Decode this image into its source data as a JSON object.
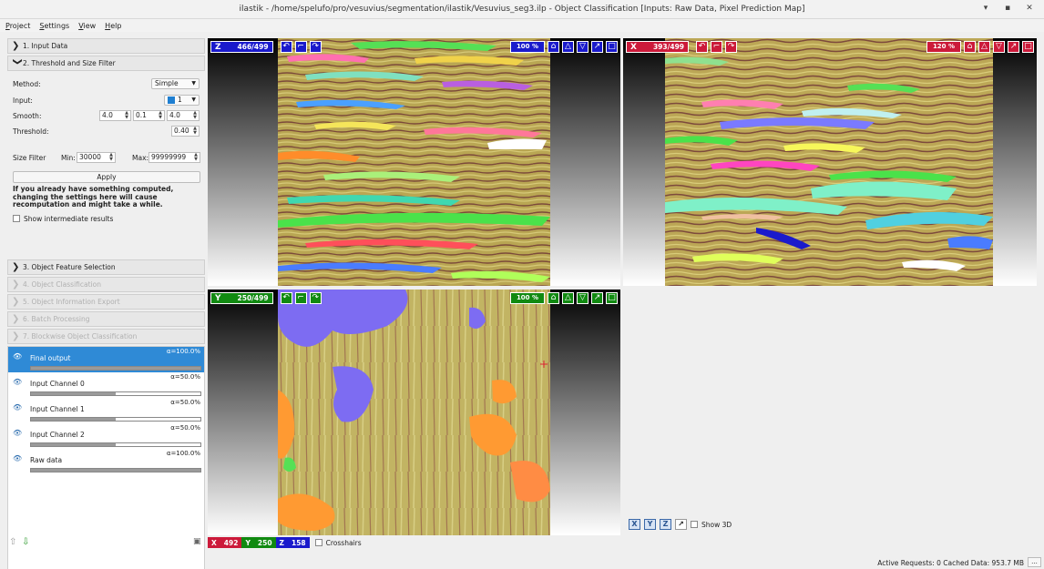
{
  "window": {
    "title": "ilastik - /home/spelufo/pro/vesuvius/segmentation/ilastik/Vesuvius_seg3.ilp - Object Classification [Inputs: Raw Data, Pixel Prediction Map]",
    "minimize": "▾",
    "maximize": "▪",
    "close": "✕"
  },
  "menu": [
    "Project",
    "Settings",
    "View",
    "Help"
  ],
  "applets": [
    {
      "label": "1. Input Data",
      "state": "collapsed",
      "enabled": true
    },
    {
      "label": "2. Threshold and Size Filter",
      "state": "expanded",
      "enabled": true
    },
    {
      "label": "3. Object Feature Selection",
      "state": "collapsed",
      "enabled": true
    },
    {
      "label": "4. Object Classification",
      "state": "collapsed",
      "enabled": false
    },
    {
      "label": "5. Object Information Export",
      "state": "collapsed",
      "enabled": false
    },
    {
      "label": "6. Batch Processing",
      "state": "collapsed",
      "enabled": false
    },
    {
      "label": "7. Blockwise Object Classification",
      "state": "collapsed",
      "enabled": false
    }
  ],
  "threshold": {
    "method_label": "Method:",
    "method_value": "Simple",
    "input_label": "Input:",
    "input_value": "1",
    "input_color": "#1f7fd1",
    "smooth_label": "Smooth:",
    "smooth_values": [
      "4.0",
      "0.1",
      "4.0"
    ],
    "threshold_label": "Threshold:",
    "threshold_value": "0.40",
    "size_filter_label": "Size Filter",
    "min_label": "Min:",
    "min_value": "30000",
    "max_label": "Max:",
    "max_value": "99999999",
    "apply_label": "Apply",
    "warning": "If you already have something computed, changing the settings here will cause recomputation and might take a while.",
    "show_intermediate_label": "Show intermediate results"
  },
  "layers": [
    {
      "name": "Final output",
      "alpha": "α=100.0%",
      "opacity": 1.0,
      "selected": true
    },
    {
      "name": "Input Channel 0",
      "alpha": "α=50.0%",
      "opacity": 0.5,
      "selected": false
    },
    {
      "name": "Input Channel 1",
      "alpha": "α=50.0%",
      "opacity": 0.5,
      "selected": false
    },
    {
      "name": "Input Channel 2",
      "alpha": "α=50.0%",
      "opacity": 0.5,
      "selected": false
    },
    {
      "name": "Raw data",
      "alpha": "α=100.0%",
      "opacity": 1.0,
      "selected": false
    }
  ],
  "viewers": {
    "z": {
      "axis": "Z",
      "slice": "466/499",
      "zoom": "100 %",
      "color": "#1a1acc"
    },
    "x": {
      "axis": "X",
      "slice": "393/499",
      "zoom": "120 %",
      "color": "#cc1a3a"
    },
    "y": {
      "axis": "Y",
      "slice": "250/499",
      "zoom": "100 %",
      "color": "#118a11"
    }
  },
  "coords": {
    "x_label": "X",
    "x_value": "492",
    "y_label": "Y",
    "y_value": "250",
    "z_label": "Z",
    "z_value": "158",
    "crosshairs_label": "Crosshairs"
  },
  "view3d": {
    "buttons": [
      "X",
      "Y",
      "Z",
      "↗"
    ],
    "show3d_label": "Show 3D"
  },
  "status": {
    "text": "Active Requests: 0  Cached Data: 953.7 MB",
    "more": "..."
  },
  "icons": {
    "chevron_right": "❯",
    "chevron_down": "❯",
    "eye": "👁",
    "undo": "↶",
    "redo": "↷",
    "camera": "⌂",
    "up": "△",
    "down": "▽",
    "expand": "↗",
    "maximize": "□"
  }
}
